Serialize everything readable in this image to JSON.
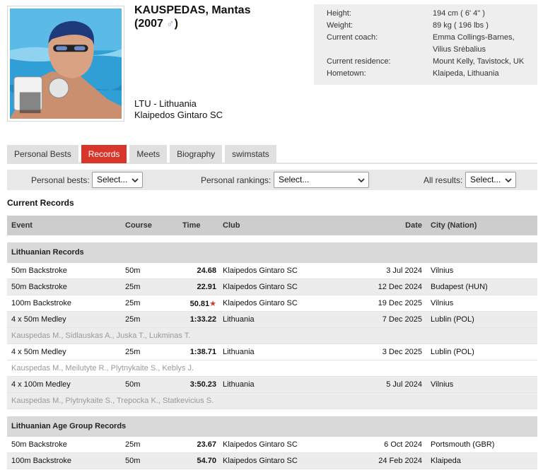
{
  "athlete": {
    "name": "KAUSPEDAS, Mantas",
    "birth_year_prefix": "(2007",
    "gender_symbol": "♂",
    "birth_year_suffix": ")",
    "nation": "LTU - Lithuania",
    "club": "Klaipedos Gintaro SC"
  },
  "info": [
    {
      "label": "Height:",
      "value": "194 cm  ( 6' 4\" )"
    },
    {
      "label": "Weight:",
      "value": "89 kg  ( 196 lbs )"
    },
    {
      "label": "Current coach:",
      "value": "Emma Collings-Barnes, Vilius Srėbalius"
    },
    {
      "label": "Current residence:",
      "value": "Mount Kelly, Tavistock, UK"
    },
    {
      "label": "Hometown:",
      "value": "Klaipeda, Lithuania"
    }
  ],
  "tabs": [
    {
      "label": "Personal Bests",
      "active": false
    },
    {
      "label": "Records",
      "active": true
    },
    {
      "label": "Meets",
      "active": false
    },
    {
      "label": "Biography",
      "active": false
    },
    {
      "label": "swimstats",
      "active": false
    }
  ],
  "filters": {
    "personal_bests_label": "Personal bests:",
    "personal_bests_value": "Select...",
    "personal_rankings_label": "Personal rankings:",
    "personal_rankings_value": "Select...",
    "all_results_label": "All results:",
    "all_results_value": "Select..."
  },
  "section_title": "Current Records",
  "columns": {
    "event": "Event",
    "course": "Course",
    "time": "Time",
    "club": "Club",
    "date": "Date",
    "city": "City (Nation)"
  },
  "groups": [
    {
      "title": "Lithuanian Records",
      "rows": [
        {
          "event": "50m Backstroke",
          "course": "50m",
          "time": "24.68",
          "club": "Klaipedos Gintaro SC",
          "date": "3 Jul 2024",
          "city": "Vilnius"
        },
        {
          "event": "50m Backstroke",
          "course": "25m",
          "time": "22.91",
          "club": "Klaipedos Gintaro SC",
          "date": "12 Dec 2024",
          "city": "Budapest (HUN)"
        },
        {
          "event": "100m Backstroke",
          "course": "25m",
          "time": "50.81",
          "star": "★",
          "club": "Klaipedos Gintaro SC",
          "date": "19 Dec 2025",
          "city": "Vilnius"
        },
        {
          "event": "4 x 50m Medley",
          "course": "25m",
          "time": "1:33.22",
          "club": "Lithuania",
          "date": "7 Dec 2025",
          "city": "Lublin (POL)",
          "relay": "Kauspedas M., Sidlauskas A., Juska T., Lukminas T."
        },
        {
          "event": "4 x 50m Medley",
          "course": "25m",
          "time": "1:38.71",
          "club": "Lithuania",
          "date": "3 Dec 2025",
          "city": "Lublin (POL)",
          "relay": "Kauspedas M., Meilutyte R., Plytnykaite S., Keblys J."
        },
        {
          "event": "4 x 100m Medley",
          "course": "50m",
          "time": "3:50.23",
          "club": "Lithuania",
          "date": "5 Jul 2024",
          "city": "Vilnius",
          "relay": "Kauspedas M., Plytnykaite S., Trepocka K., Statkevicius S."
        }
      ]
    },
    {
      "title": "Lithuanian Age Group Records",
      "rows": [
        {
          "event": "50m Backstroke",
          "course": "25m",
          "time": "23.67",
          "club": "Klaipedos Gintaro SC",
          "date": "6 Oct 2024",
          "city": "Portsmouth (GBR)"
        },
        {
          "event": "100m Backstroke",
          "course": "50m",
          "time": "54.70",
          "club": "Klaipedos Gintaro SC",
          "date": "24 Feb 2024",
          "city": "Klaipeda"
        }
      ]
    }
  ]
}
